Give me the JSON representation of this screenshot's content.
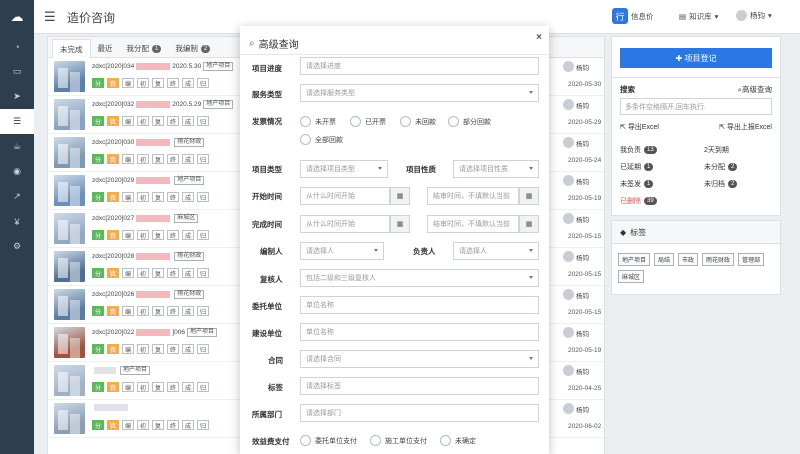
{
  "header": {
    "title": "造价咨询",
    "messages_label": "信息价",
    "messages_icon_text": "行",
    "knowledge_label": "知识库",
    "user_name": "杨钧"
  },
  "tabs": [
    {
      "label": "未完成",
      "count": ""
    },
    {
      "label": "最近",
      "count": ""
    },
    {
      "label": "我分配",
      "count": "1"
    },
    {
      "label": "我编制",
      "count": "2"
    }
  ],
  "row_buttons": [
    "分",
    "我",
    "编",
    "初",
    "复",
    "终",
    "成",
    "归"
  ],
  "rows": [
    {
      "code": "zdxc[2020]034",
      "date_text": "2020.5.30",
      "tag": "地产项目",
      "user": "杨钧",
      "date": "2020-05-30",
      "color": "#5b7fa8"
    },
    {
      "code": "zdxc[2020]032",
      "date_text": "2020.5.29",
      "tag": "地产项目",
      "user": "杨钧",
      "date": "2020-05-29",
      "color": "#8aa2bf"
    },
    {
      "code": "zdxc[2020]030",
      "date_text": "",
      "tag": "雨花财政",
      "user": "杨钧",
      "date": "2020-05-24",
      "color": "#7d99b3"
    },
    {
      "code": "zdxc[2020]029",
      "date_text": "",
      "tag": "地产项目",
      "user": "杨钧",
      "date": "2020-05-19",
      "color": "#6a8fb9"
    },
    {
      "code": "zdxc[2020]027",
      "date_text": "",
      "tag": "麻城区",
      "user": "杨钧",
      "date": "2020-05-15",
      "color": "#93a9c3"
    },
    {
      "code": "zdxc[2020]028",
      "date_text": "",
      "tag": "雨花财政",
      "user": "杨钧",
      "date": "2020-05-15",
      "color": "#4f6f93"
    },
    {
      "code": "zdxc[2020]026",
      "date_text": "",
      "tag": "雨花财政",
      "user": "杨钧",
      "date": "2020-05-15",
      "color": "#5a7ba0"
    },
    {
      "code": "zdxc[2020]022",
      "date_text": "]006",
      "tag": "地产项目",
      "user": "杨钧",
      "date": "2020-05-19",
      "color": "#a0523f"
    },
    {
      "code": "",
      "date_text": "",
      "tag": "地产项目",
      "user": "杨钧",
      "date": "2020-04-25",
      "color": "#9fb2c6"
    },
    {
      "code": "",
      "date_text": "",
      "tag": "",
      "user": "杨钧",
      "date": "2020-06-02",
      "color": "#8b9fb4"
    }
  ],
  "right_panel": {
    "register_label": "项目登记",
    "search_label": "搜索",
    "advanced_label": "高级查询",
    "search_placeholder": "多条件空格隔开,回车执行.",
    "export_label": "导出Excel",
    "export_upper_label": "导出上报Excel",
    "stats": [
      {
        "label": "我负责",
        "count": "13"
      },
      {
        "label": "2天到期",
        "count": ""
      },
      {
        "label": "已延期",
        "count": "1"
      },
      {
        "label": "未分配",
        "count": "2"
      },
      {
        "label": "未签发",
        "count": "1"
      },
      {
        "label": "未归档",
        "count": "2"
      },
      {
        "label": "已删除",
        "count": "39"
      }
    ]
  },
  "tags_panel": {
    "title": "标签",
    "tags": [
      "地产项目",
      "局结",
      "市政",
      "雨花财政",
      "管理部",
      "麻城区"
    ]
  },
  "modal": {
    "title": "高级查询",
    "close": "×",
    "progress_label": "项目进度",
    "progress_ph": "请选择进度",
    "service_label": "服务类型",
    "service_ph": "请选择服务类型",
    "invoice_label": "发票情况",
    "invoice_opts": [
      "未开票",
      "已开票",
      "未回款",
      "部分回款",
      "全部回款"
    ],
    "ptype_label": "项目类型",
    "ptype_ph": "请选择项目类型",
    "pnature_label": "项目性质",
    "pnature_ph": "请选择项目性质",
    "start_label": "开始时间",
    "start_from_ph": "从什么时间开始",
    "start_to_ph": "结审时间，不填默认当前",
    "finish_label": "完成时间",
    "finish_from_ph": "从什么时间开始",
    "finish_to_ph": "结审时间，不填默认当前",
    "author_label": "编制人",
    "author_ph": "请选择人",
    "owner_label": "负责人",
    "owner_ph": "请选择人",
    "reviewer_label": "复核人",
    "reviewer_ph": "包括二级和三级复核人",
    "client_label": "委托单位",
    "client_ph": "单位名称",
    "builder_label": "建设单位",
    "builder_ph": "单位名称",
    "contract_label": "合同",
    "contract_ph": "请选择合同",
    "tag_label": "标签",
    "tag_ph": "请选择标签",
    "dept_label": "所属部门",
    "dept_ph": "请选择部门",
    "fee_label": "效益费支付",
    "fee_opts": [
      "委托单位支付",
      "施工单位支付",
      "未确定"
    ]
  }
}
